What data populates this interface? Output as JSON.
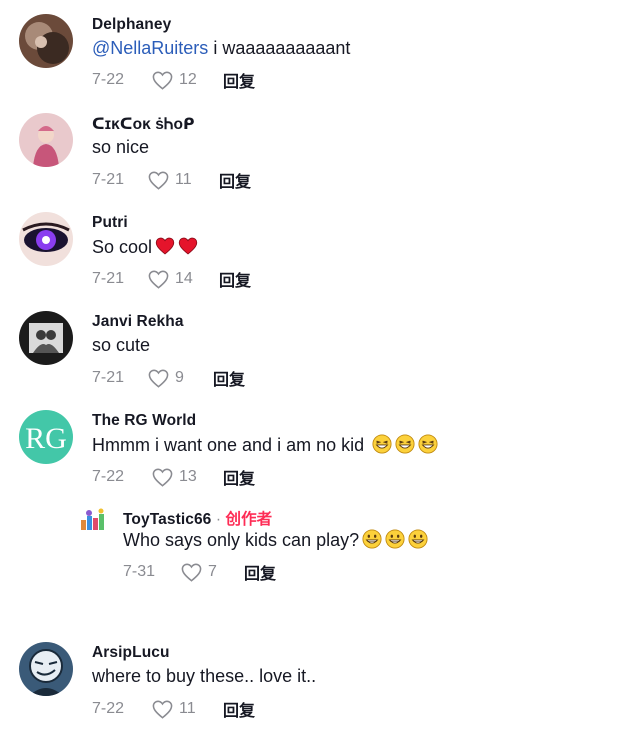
{
  "comments": [
    {
      "username": "Delphaney",
      "mention": "@NellaRuiters",
      "text": " i waaaaaaaaaant",
      "date": "7-22",
      "likes": "12",
      "reply": "回复"
    },
    {
      "username": "ᑕɪĸᑕᴏĸ ṡᏂᴏᑭ",
      "text": "so nice",
      "date": "7-21",
      "likes": "11",
      "reply": "回复"
    },
    {
      "username": "Putri",
      "text": "So cool",
      "date": "7-21",
      "likes": "14",
      "reply": "回复"
    },
    {
      "username": "Janvi Rekha",
      "text": "so cute",
      "date": "7-21",
      "likes": "9",
      "reply": "回复"
    },
    {
      "username": "The RG World",
      "text": "Hmmm i want one and i am no kid ",
      "date": "7-22",
      "likes": "13",
      "reply": "回复"
    },
    {
      "username": "ArsipLucu",
      "text": "where to buy these.. love it..",
      "date": "7-22",
      "likes": "11",
      "reply": "回复"
    }
  ],
  "reply_comment": {
    "username": "ToyTastic66",
    "separator": " · ",
    "creator_label": "创作者",
    "text": "Who says only kids can play?",
    "date": "7-31",
    "likes": "7",
    "reply": "回复"
  },
  "colors": {
    "accent": "#fe2c55",
    "mention": "#2b5db9",
    "muted": "#8a8b91"
  },
  "icons": [
    "heart-outline-icon",
    "red-heart-emoji",
    "grinning-squinting-emoji",
    "grinning-emoji"
  ]
}
